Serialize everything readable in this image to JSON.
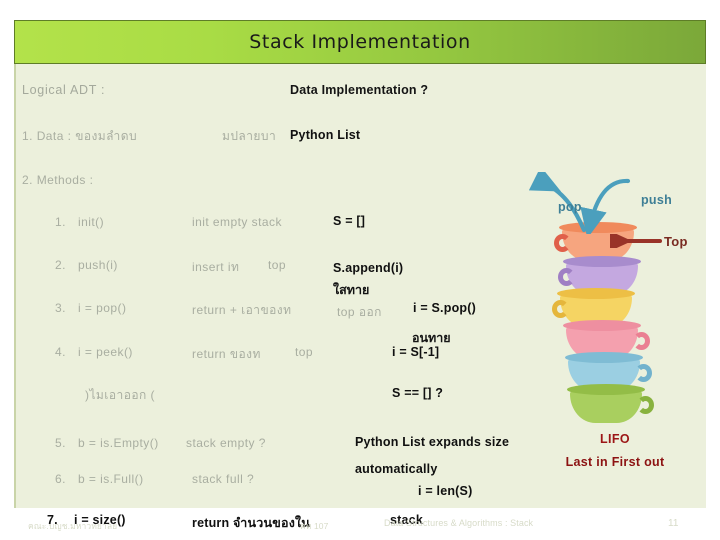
{
  "slide": {
    "title": "Stack Implementation",
    "background_color": "#ecf0dc",
    "title_gradient_from": "#b3e24a",
    "title_gradient_to": "#7ba839"
  },
  "columns": {
    "left_header": "Logical ADT :",
    "right_header": "Data Implementation ?"
  },
  "sections": {
    "data_label": "1.  Data : ของมลำดบ",
    "data_thai_mid": "มปลายบา",
    "data_impl": "Python List",
    "methods_label": "2.  Methods :"
  },
  "methods": [
    {
      "num": "1.",
      "adt": "init()",
      "desc": "init empty stack",
      "impl": "S = []"
    },
    {
      "num": "2.",
      "adt": "push(i)",
      "desc": "insert iท",
      "desc2": "top",
      "impl": "S.append(i)",
      "thai_note": "ใสทาย"
    },
    {
      "num": "3.",
      "adt": "i = pop()",
      "desc": "return + เอาของท",
      "desc2": "top  ออก",
      "impl": "i =  S.pop()"
    },
    {
      "num": "4.",
      "adt": "i = peek()",
      "desc": "return ของท",
      "desc2": "top",
      "impl": "i =  S[-1]",
      "thai_note": "อนทาย"
    },
    {
      "num": "",
      "adt": "",
      "desc": ")ไมเอาออก  (",
      "impl": "S ==  [] ?"
    },
    {
      "num": "5.",
      "adt": "b = is.Empty()",
      "desc": "stack empty ?",
      "impl": "Python List expands size"
    },
    {
      "num": "6.",
      "adt": "b = is.Full()",
      "desc": "stack full ?",
      "impl": "automatically",
      "impl2": "i = len(S)"
    },
    {
      "num": "7.",
      "adt": "i = size()",
      "desc": "return จำนวนของใน",
      "desc2": "stack"
    }
  ],
  "illustration": {
    "pop_label": "pop",
    "push_label": "push",
    "top_label": "Top",
    "arrow_color": "#4b9fbd",
    "top_arrow_color": "#993328",
    "cups": [
      {
        "name": "cup-orange",
        "body": "#f6a57f",
        "rim": "#f08a5c",
        "handle": "#e0604a"
      },
      {
        "name": "cup-purple",
        "body": "#c4a8e0",
        "rim": "#a88ccd",
        "handle": "#9f7fc4"
      },
      {
        "name": "cup-yellow",
        "body": "#f5d463",
        "rim": "#edbf45",
        "handle": "#e5b63c"
      },
      {
        "name": "cup-pink",
        "body": "#f4a0ae",
        "rim": "#ee8fa0",
        "handle": "#ea8092"
      },
      {
        "name": "cup-blue",
        "body": "#9bcfe2",
        "rim": "#7fbcd4",
        "handle": "#72b2cd"
      },
      {
        "name": "cup-green",
        "body": "#a9cf5f",
        "rim": "#93bd47",
        "handle": "#88b23e"
      }
    ]
  },
  "lifo": {
    "title": "LIFO",
    "subtitle": "Last in First out",
    "color": "#9c1616"
  },
  "footer": {
    "course_thai": "คณะ.บญช.มหาวทยาลย",
    "code": "คท 107",
    "title": "Data Structures & Algorithms : Stack",
    "page": "11"
  }
}
